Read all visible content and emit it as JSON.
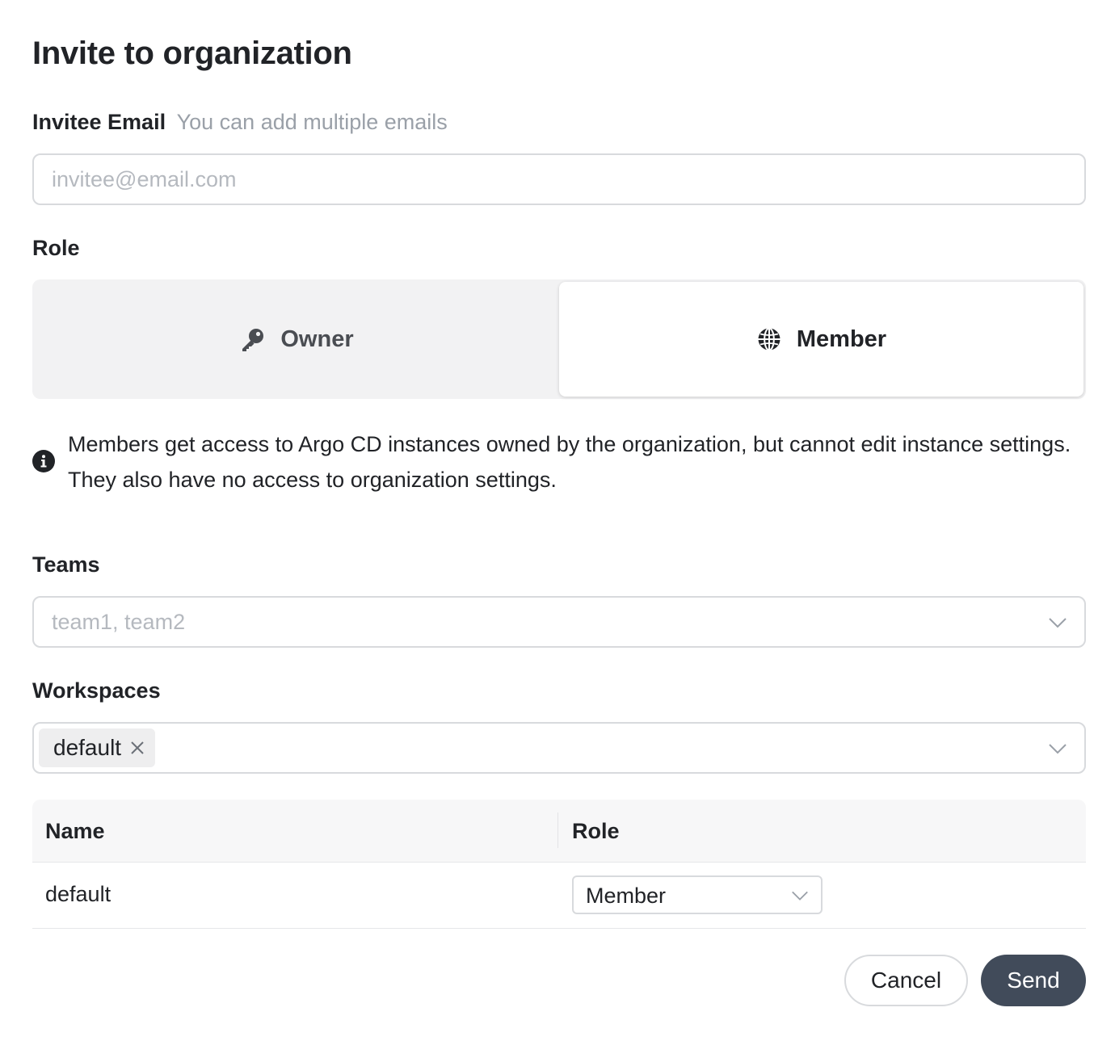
{
  "dialog": {
    "title": "Invite to organization"
  },
  "email": {
    "label": "Invitee Email",
    "hint": "You can add multiple emails",
    "placeholder": "invitee@email.com",
    "value": ""
  },
  "role": {
    "label": "Role",
    "options": [
      {
        "label": "Owner",
        "icon": "key-icon",
        "selected": false
      },
      {
        "label": "Member",
        "icon": "globe-icon",
        "selected": true
      }
    ],
    "info_icon": "info-icon",
    "description": "Members get access to Argo CD instances owned by the organization, but cannot edit instance settings. They also have no access to organization settings."
  },
  "teams": {
    "label": "Teams",
    "placeholder": "team1, team2"
  },
  "workspaces": {
    "label": "Workspaces",
    "selected_tags": [
      "default"
    ],
    "table": {
      "columns": [
        "Name",
        "Role"
      ],
      "rows": [
        {
          "name": "default",
          "role": "Member"
        }
      ]
    }
  },
  "actions": {
    "cancel_label": "Cancel",
    "send_label": "Send"
  },
  "colors": {
    "primary_button": "#414b5a",
    "border": "#d8dadd",
    "segment_bg": "#f2f2f3",
    "hint_text": "#9aa0a8"
  }
}
